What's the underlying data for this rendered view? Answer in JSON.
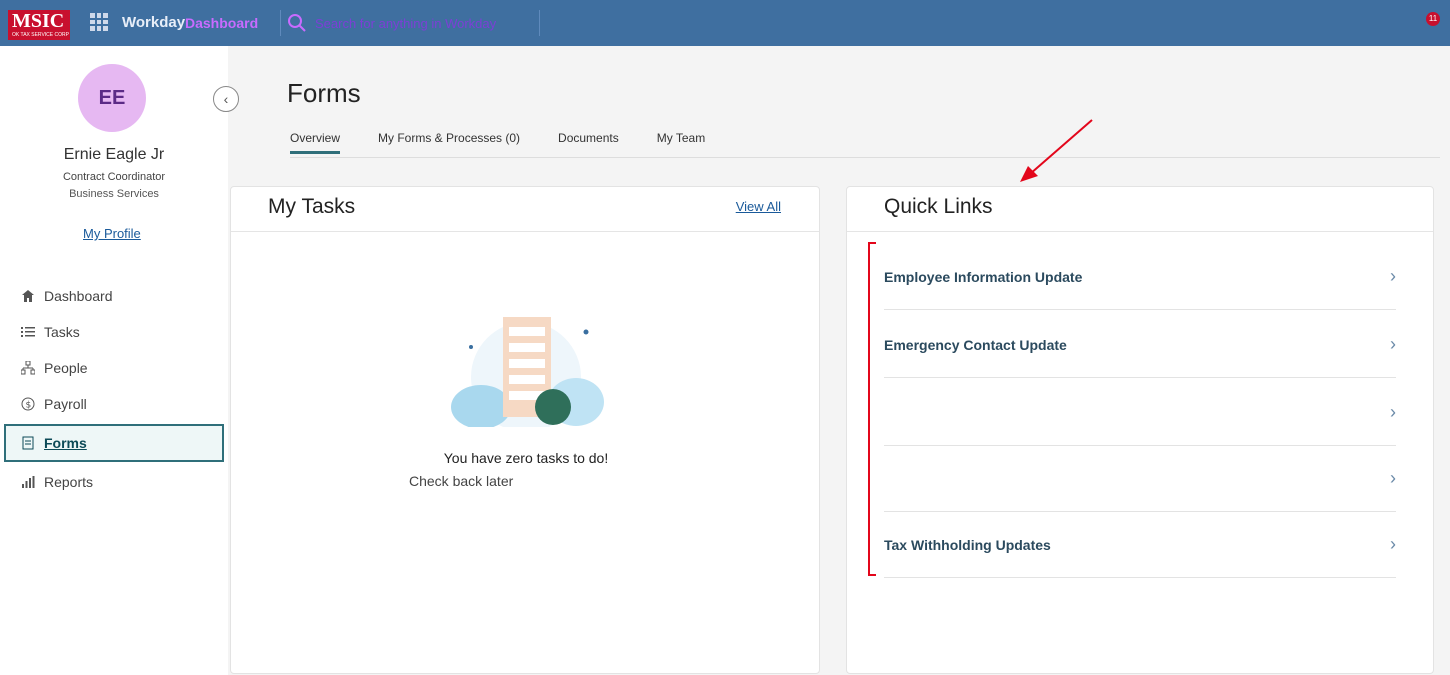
{
  "topbar": {
    "logo_text": "MSIC",
    "logo_subtext": "OK TAX SERVICE CORP",
    "app_label": "Workday",
    "dashboard_label": "Dashboard",
    "search_placeholder": "Search for anything in Workday",
    "notification_count": "11"
  },
  "sidebar": {
    "avatar_initials": "EE",
    "user_name": "Ernie Eagle Jr",
    "user_title": "Contract Coordinator",
    "user_dept": "Business Services",
    "profile_link": "My Profile",
    "items": [
      {
        "label": "Dashboard",
        "icon": "home-icon"
      },
      {
        "label": "Tasks",
        "icon": "tasks-icon"
      },
      {
        "label": "People",
        "icon": "org-chart-icon"
      },
      {
        "label": "Payroll",
        "icon": "money-icon"
      },
      {
        "label": "Forms",
        "icon": "forms-icon"
      },
      {
        "label": "Reports",
        "icon": "chart-icon"
      }
    ]
  },
  "page": {
    "title": "Forms",
    "tabs": [
      {
        "label": "Overview"
      },
      {
        "label": "My Forms & Processes (0)"
      },
      {
        "label": "Documents"
      },
      {
        "label": "My Team"
      }
    ]
  },
  "tasks": {
    "title": "My Tasks",
    "view_all": "View All",
    "empty_title": "You have zero tasks to do!",
    "empty_sub": "Check back later"
  },
  "quick_links": {
    "title": "Quick Links",
    "items": [
      {
        "label": "Employee Information Update"
      },
      {
        "label": "Emergency Contact Update"
      },
      {
        "label": ""
      },
      {
        "label": ""
      },
      {
        "label": "Tax Withholding Updates"
      }
    ]
  },
  "colors": {
    "topbar": "#3f6fa0",
    "accent": "#2f6f7a",
    "annotation": "#e3061b"
  }
}
